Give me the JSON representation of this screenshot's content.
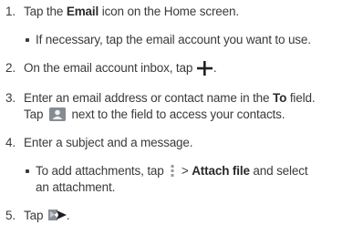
{
  "steps": [
    {
      "num": "1.",
      "pre": "Tap the ",
      "bold": "Email",
      "post": " icon on the Home screen."
    },
    {
      "bullet": "If necessary, tap the email account you want to use."
    },
    {
      "num": "2.",
      "pre": "On the email account inbox, tap ",
      "icon": "plus-icon",
      "post": "."
    },
    {
      "num": "3.",
      "pre": "Enter an email address or contact name in the ",
      "bold": "To",
      "post": " field.",
      "line2_pre": "Tap ",
      "line2_icon": "contact-icon",
      "line2_post": " next to the field to access your contacts."
    },
    {
      "num": "4.",
      "pre": "Enter a subject and a message."
    },
    {
      "bullet_pre": "To add attachments, tap ",
      "bullet_icon": "menu-icon",
      "bullet_mid": " > ",
      "bullet_bold": "Attach file",
      "bullet_post": " and select",
      "bullet_line2": "an attachment."
    },
    {
      "num": "5.",
      "pre": "Tap ",
      "icon": "send-icon",
      "post": "."
    }
  ]
}
